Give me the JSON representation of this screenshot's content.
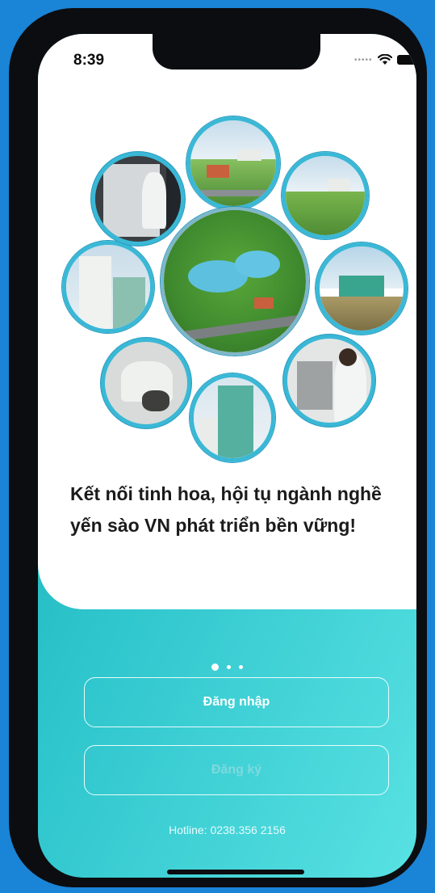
{
  "status_bar": {
    "time": "8:39"
  },
  "tagline": "Kết nối tinh hoa, hội tụ ngành nghề yến sào VN phát triển bền vững!",
  "pagination": {
    "total": 3,
    "active": 0
  },
  "buttons": {
    "login": "Đăng nhập",
    "register": "Đăng ký"
  },
  "footer": {
    "hotline": "Hotline: 0238.356 2156"
  },
  "colors": {
    "accent": "#2fc6cd",
    "ring": "#3ab8d6",
    "background": "#1a84d6"
  },
  "icons": [
    "wifi-icon",
    "battery-icon",
    "signal-dots-icon"
  ]
}
